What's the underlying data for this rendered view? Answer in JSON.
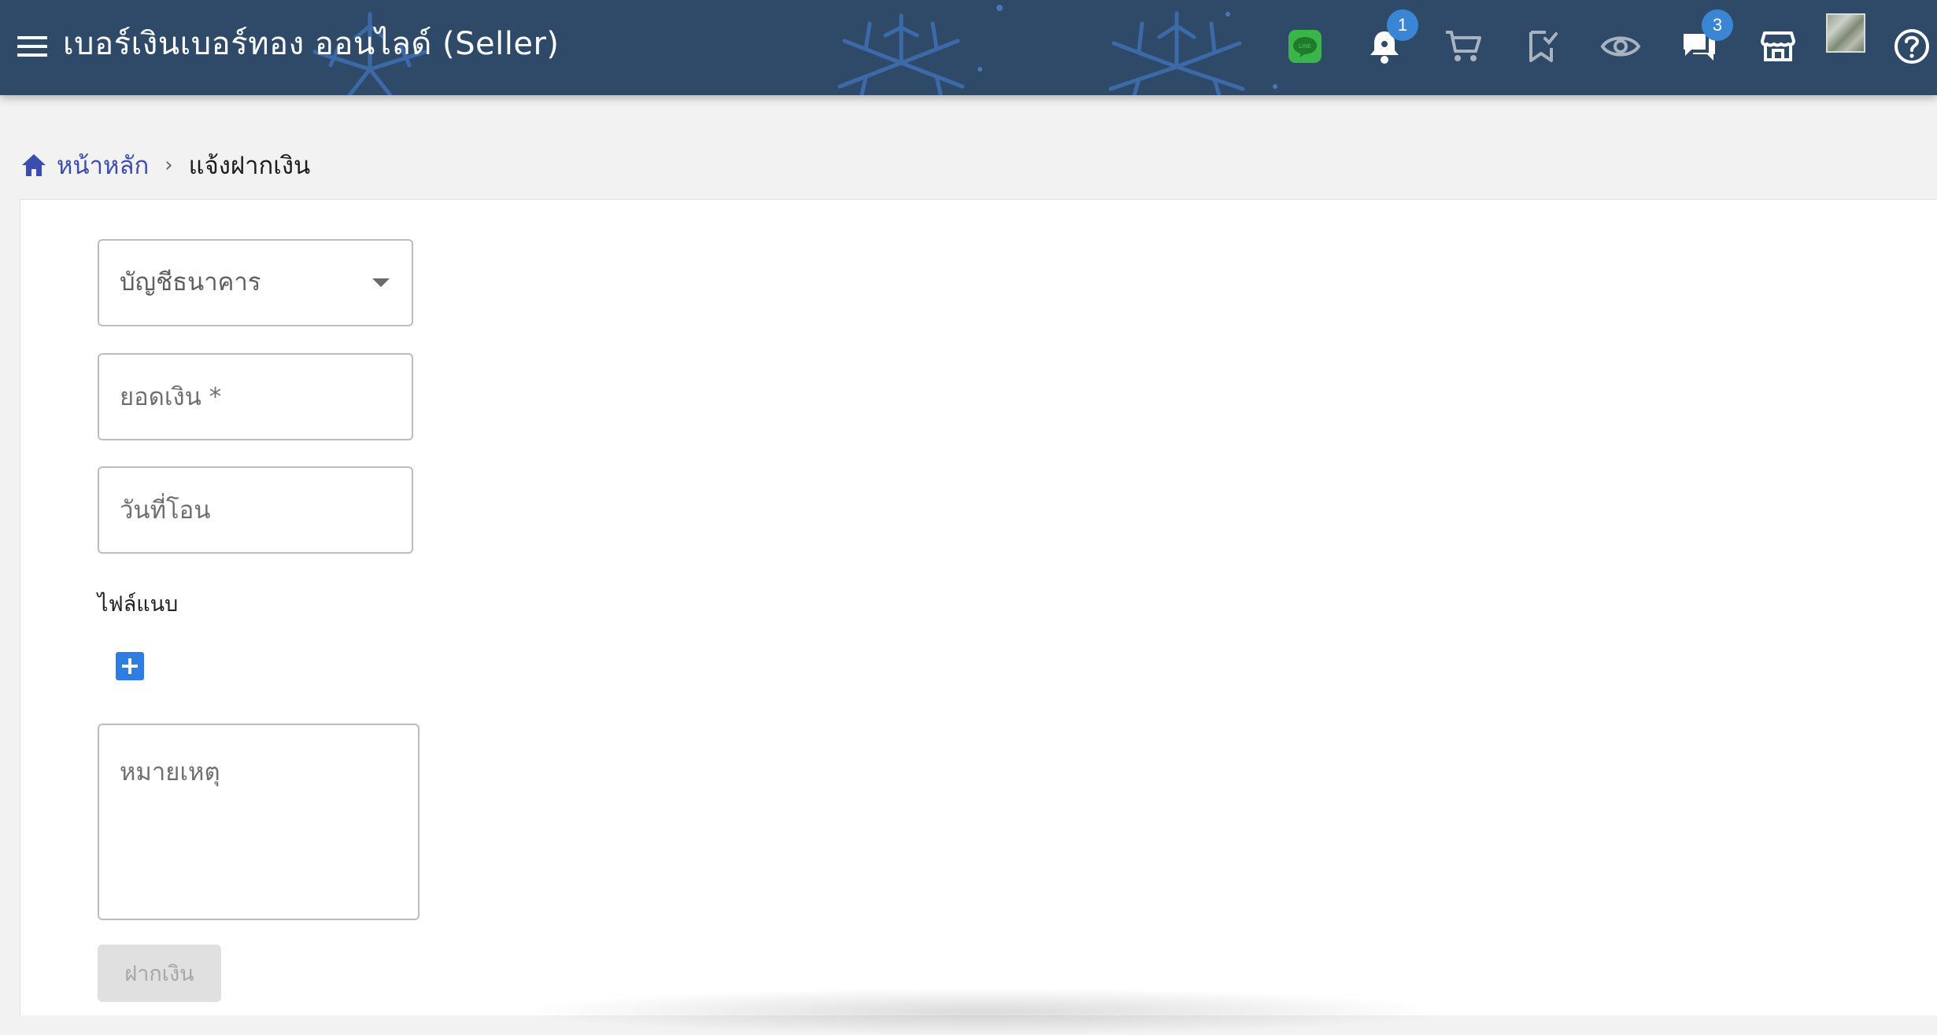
{
  "header": {
    "title": "เบอร์เงินเบอร์ทอง ออนไลด์ (Seller)",
    "menu_icon": "hamburger-menu-icon",
    "icons": [
      {
        "name": "line-icon",
        "color": "#39b54a",
        "label": "LINE"
      },
      {
        "name": "notification-bell-icon",
        "badge": "1"
      },
      {
        "name": "shopping-cart-icon"
      },
      {
        "name": "bookmark-check-icon"
      },
      {
        "name": "eye-icon"
      },
      {
        "name": "chat-bubbles-icon",
        "badge": "3"
      },
      {
        "name": "storefront-icon"
      },
      {
        "name": "user-avatar"
      },
      {
        "name": "help-circle-icon"
      }
    ],
    "colors": {
      "background": "#2f4a69",
      "snowflake": "#3f6fb0",
      "badge": "#3a86d4"
    }
  },
  "breadcrumb": {
    "home_label": "หน้าหลัก",
    "separator": "›",
    "current": "แจ้งฝากเงิน",
    "link_color": "#3b4dae"
  },
  "form": {
    "bank_account_label": "บัญชีธนาคาร",
    "amount_placeholder": "ยอดเงิน *",
    "transfer_date_placeholder": "วันที่โอน",
    "attachment_label": "ไฟล์แนบ",
    "add_attachment_icon": "plus-icon",
    "note_placeholder": "หมายเหตุ",
    "submit_label": "ฝากเงิน",
    "submit_enabled": false
  }
}
